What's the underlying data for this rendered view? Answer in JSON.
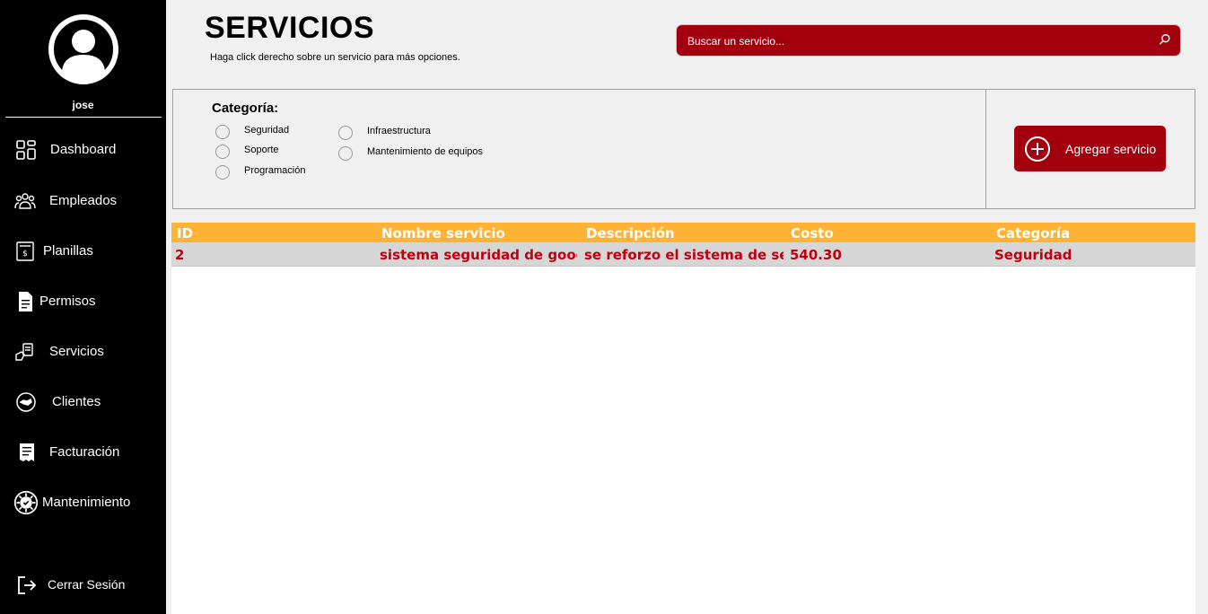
{
  "sidebar": {
    "username": "jose",
    "items": [
      {
        "label": "Dashboard",
        "icon": "dashboard-icon"
      },
      {
        "label": "Empleados",
        "icon": "employees-icon"
      },
      {
        "label": "Planillas",
        "icon": "payroll-icon"
      },
      {
        "label": "Permisos",
        "icon": "permissions-icon"
      },
      {
        "label": "Servicios",
        "icon": "services-icon"
      },
      {
        "label": "Clientes",
        "icon": "clients-icon"
      },
      {
        "label": "Facturación",
        "icon": "billing-icon"
      },
      {
        "label": "Mantenimiento",
        "icon": "maintenance-icon"
      }
    ],
    "logout_label": "Cerrar Sesión"
  },
  "header": {
    "title": "SERVICIOS",
    "hint": "Haga click derecho sobre un servicio para más opciones."
  },
  "search": {
    "placeholder": "Buscar un servicio..."
  },
  "filter": {
    "title": "Categoría:",
    "options": [
      "Seguridad",
      "Soporte",
      "Programación",
      "Infraestructura",
      "Mantenimiento de equipos"
    ]
  },
  "actions": {
    "add_label": "Agregar servicio"
  },
  "table": {
    "columns": [
      "ID",
      "Nombre servicio",
      "Descripción",
      "Costo",
      "Categoría"
    ],
    "rows": [
      [
        "2",
        "sistema seguridad de google",
        "se reforzo el sistema de seg...",
        "540.30",
        "Seguridad"
      ]
    ]
  },
  "colors": {
    "accent": "#a3000f",
    "table_header": "#ffb233",
    "row_text": "#c0000f",
    "sidebar": "#000000"
  }
}
